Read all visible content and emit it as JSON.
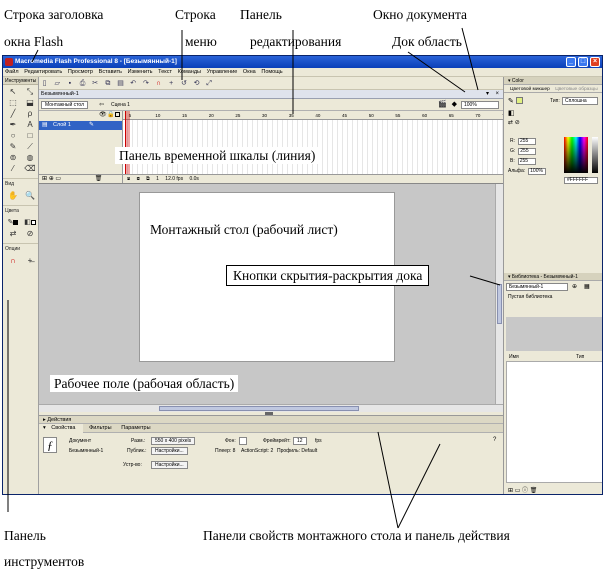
{
  "annotations": {
    "title_bar": "Строка заголовка",
    "title_bar_2": "окна Flash",
    "menu_line": "Строка",
    "menu_line_2": "меню",
    "edit_panel": "Панель",
    "edit_panel_2": "редактирования",
    "doc_window": "Окно документа",
    "dock_area": "Док область",
    "timeline": "Панель временной шкалы (линия)",
    "stage": "Монтажный стол (рабочий лист)",
    "dock_buttons": "Кнопки скрытия-раскрытия  дока",
    "work_area": "Рабочее поле (рабочая  область)",
    "tools_panel": "Панель",
    "tools_panel_2": "инструментов",
    "props_actions": "Панели свойств монтажного стола и панель действия"
  },
  "window": {
    "title": "Macromedia Flash Professional 8 - [Безымянный-1]",
    "min_btn": "_",
    "max_btn": "□",
    "close_btn": "×"
  },
  "menu": [
    "Файл",
    "Редактировать",
    "Просмотр",
    "Вставить",
    "Изменить",
    "Текст",
    "Команды",
    "Управление",
    "Окна",
    "Помощь"
  ],
  "tools": {
    "header": "Инструменты",
    "glyphs": [
      "↖",
      "⤡",
      "⬚",
      "⬓",
      "╱",
      "ρ",
      "✒",
      "A",
      "○",
      "□",
      "✎",
      "⟋",
      "⊚",
      "◍",
      "⁄",
      "⌫"
    ],
    "view_label": "Вид",
    "view_glyphs": [
      "✋",
      "🔍"
    ],
    "colors_label": "Цвета",
    "options_label": "Опции"
  },
  "document": {
    "tab": "Безымянный-1",
    "scene_tab": "Монтажный стол",
    "scene": "Сцена 1",
    "zoom": "100%"
  },
  "timeline": {
    "layer": "Слой 1",
    "frames": [
      "5",
      "10",
      "15",
      "20",
      "25",
      "30",
      "35",
      "40",
      "45",
      "50",
      "55",
      "60",
      "65",
      "70",
      "75",
      "80",
      "85"
    ],
    "status": [
      "1",
      "12.0 fps",
      "0.0s"
    ]
  },
  "actions": {
    "label": "Действия"
  },
  "properties": {
    "tabs": [
      "Свойства",
      "Фильтры",
      "Параметры"
    ],
    "doc_type": "Документ",
    "doc_name": "Безымянный-1",
    "size_label": "Разм.:",
    "size_value": "550 x 400 pixels",
    "publish_label": "Публик.:",
    "settings_btn": "Настройки...",
    "device_label": "Устр-во:",
    "bg_label": "Фон:",
    "fps_label": "Фреймрейт:",
    "fps_value": "12",
    "fps_unit": "fps",
    "player": "Плеер: 8",
    "actionscript": "ActionScript: 2",
    "profile": "Профиль: Default"
  },
  "dock": {
    "color_header": "Color",
    "color_tabs": [
      "Цветовой микшер",
      "Цветовые образцы"
    ],
    "type_label": "Тип:",
    "type_value": "Сплошна",
    "r_label": "R:",
    "g_label": "G:",
    "b_label": "B:",
    "r": "255",
    "g": "255",
    "b": "255",
    "alpha_label": "Альфа:",
    "alpha": "100%",
    "hex": "#FFFFFF",
    "library_header": "Библиотека - Безымянный-1",
    "library_doc": "Безымянный-1",
    "library_empty": "Пустая библиотека",
    "col_name": "Имя",
    "col_type": "Тип"
  }
}
